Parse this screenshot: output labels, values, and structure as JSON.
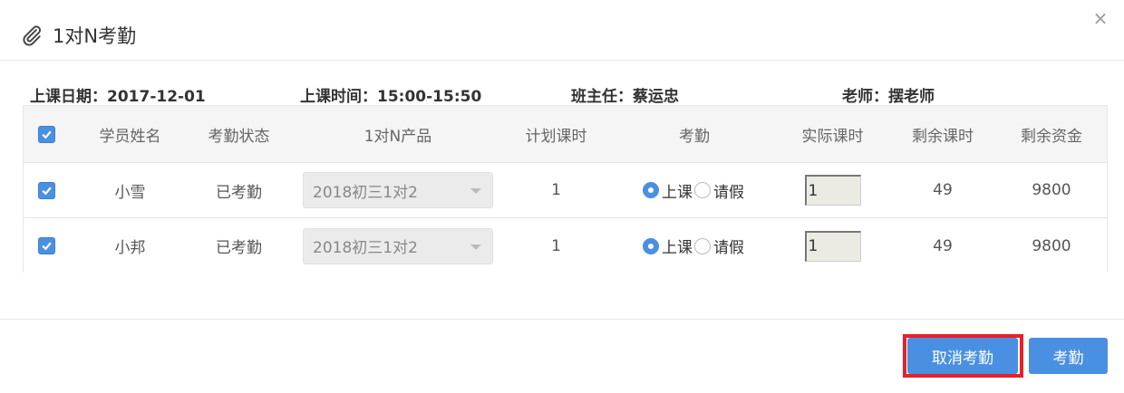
{
  "dialog": {
    "title": "1对N考勤",
    "close_label": "×"
  },
  "info": {
    "date": "上课日期：2017-12-01",
    "time": "上课时间：15:00-15:50",
    "head_teacher": "班主任：蔡运忠",
    "teacher": "老师：摆老师"
  },
  "table": {
    "headers": {
      "name": "学员姓名",
      "status": "考勤状态",
      "product": "1对N产品",
      "planned": "计划课时",
      "attendance": "考勤",
      "actual": "实际课时",
      "remaining_hours": "剩余课时",
      "remaining_funds": "剩余资金"
    },
    "rows": [
      {
        "checked": true,
        "name": "小雪",
        "status": "已考勤",
        "product": "2018初三1对2",
        "planned": "1",
        "attend_label": "上课",
        "leave_label": "请假",
        "selected": "上课",
        "actual": "1",
        "remaining_hours": "49",
        "remaining_funds": "9800"
      },
      {
        "checked": true,
        "name": "小邦",
        "status": "已考勤",
        "product": "2018初三1对2",
        "planned": "1",
        "attend_label": "上课",
        "leave_label": "请假",
        "selected": "上课",
        "actual": "1",
        "remaining_hours": "49",
        "remaining_funds": "9800"
      }
    ]
  },
  "footer": {
    "cancel_label": "取消考勤",
    "confirm_label": "考勤"
  },
  "colors": {
    "accent": "#4a90e2",
    "highlight": "#e8202a"
  }
}
